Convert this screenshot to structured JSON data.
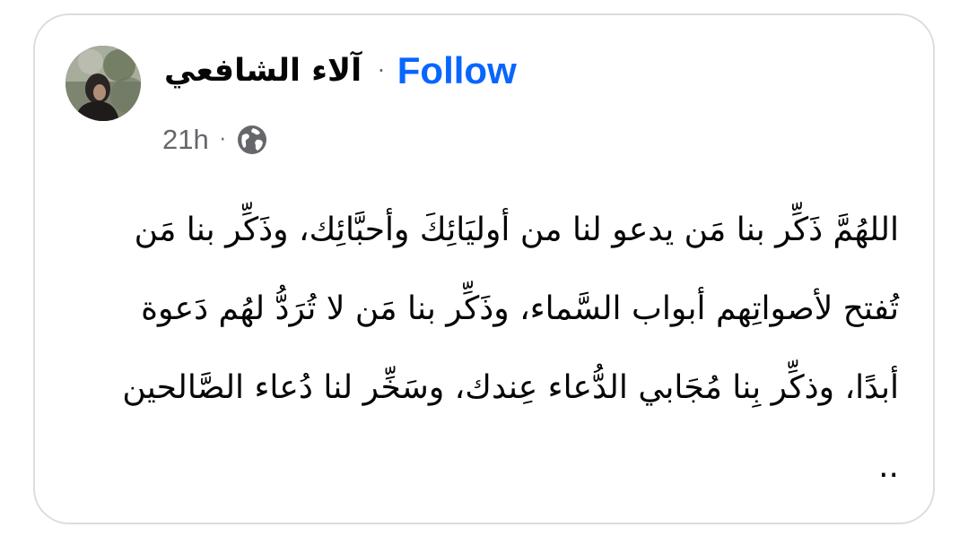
{
  "post": {
    "author": "آلاء الشافعي",
    "separator": "·",
    "follow_label": "Follow",
    "timestamp": "21h",
    "meta_separator": "·",
    "audience_icon": "globe-icon",
    "body": "اللهُمَّ ذَكِّر بنا مَن يدعو لنا من أوليَائِكَ وأحبَّائِك، وذَكِّر بنا مَن تُفتح لأصواتِهم أبواب السَّماء، وذَكِّر بنا مَن لا تُرَدُّ لهُم دَعوة أبدًا، وذكِّر بِنا مُجَابي الدُّعاء عِندك، وسَخِّر لنا دُعاء الصَّالحين .."
  },
  "colors": {
    "follow": "#0866ff",
    "text": "#050505",
    "secondary": "#65676b",
    "border": "#dadde1"
  }
}
